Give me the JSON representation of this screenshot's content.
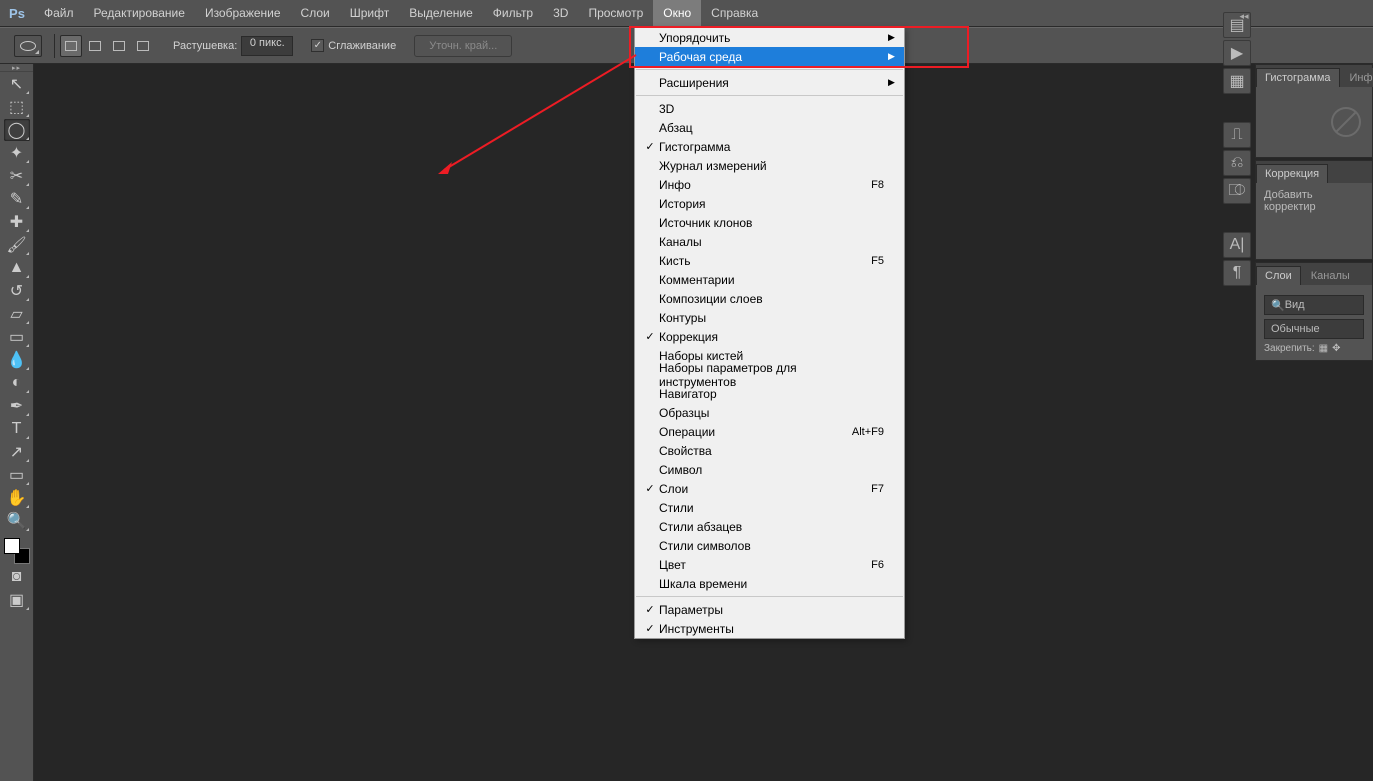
{
  "menubar": {
    "logo": "Ps",
    "items": [
      "Файл",
      "Редактирование",
      "Изображение",
      "Слои",
      "Шрифт",
      "Выделение",
      "Фильтр",
      "3D",
      "Просмотр",
      "Окно",
      "Справка"
    ],
    "active_index": 9
  },
  "options": {
    "feather_label": "Растушевка:",
    "feather_value": "0 пикс.",
    "antialias_label": "Сглаживание",
    "refine_label": "Уточн. край..."
  },
  "tools": [
    {
      "name": "move-tool",
      "glyph": "↖"
    },
    {
      "name": "marquee-tool",
      "glyph": "⬚"
    },
    {
      "name": "lasso-tool",
      "glyph": "◯",
      "selected": true
    },
    {
      "name": "wand-tool",
      "glyph": "✦"
    },
    {
      "name": "crop-tool",
      "glyph": "✂"
    },
    {
      "name": "eyedropper-tool",
      "glyph": "✎"
    },
    {
      "name": "heal-tool",
      "glyph": "✚"
    },
    {
      "name": "brush-tool",
      "glyph": "🖌"
    },
    {
      "name": "stamp-tool",
      "glyph": "▲"
    },
    {
      "name": "history-brush-tool",
      "glyph": "↺"
    },
    {
      "name": "eraser-tool",
      "glyph": "▱"
    },
    {
      "name": "gradient-tool",
      "glyph": "▭"
    },
    {
      "name": "blur-tool",
      "glyph": "💧"
    },
    {
      "name": "dodge-tool",
      "glyph": "◐"
    },
    {
      "name": "pen-tool",
      "glyph": "✒"
    },
    {
      "name": "type-tool",
      "glyph": "T"
    },
    {
      "name": "path-tool",
      "glyph": "↗"
    },
    {
      "name": "shape-tool",
      "glyph": "▭"
    },
    {
      "name": "hand-tool",
      "glyph": "✋"
    },
    {
      "name": "zoom-tool",
      "glyph": "🔍"
    }
  ],
  "dropdown": {
    "sections": [
      [
        {
          "label": "Упорядочить",
          "submenu": true
        },
        {
          "label": "Рабочая среда",
          "submenu": true,
          "highlight": true
        }
      ],
      [
        {
          "label": "Расширения",
          "submenu": true
        }
      ],
      [
        {
          "label": "3D"
        },
        {
          "label": "Абзац"
        },
        {
          "label": "Гистограмма",
          "checked": true
        },
        {
          "label": "Журнал измерений"
        },
        {
          "label": "Инфо",
          "shortcut": "F8"
        },
        {
          "label": "История"
        },
        {
          "label": "Источник клонов"
        },
        {
          "label": "Каналы"
        },
        {
          "label": "Кисть",
          "shortcut": "F5"
        },
        {
          "label": "Комментарии"
        },
        {
          "label": "Композиции слоев"
        },
        {
          "label": "Контуры"
        },
        {
          "label": "Коррекция",
          "checked": true
        },
        {
          "label": "Наборы кистей"
        },
        {
          "label": "Наборы параметров для инструментов"
        },
        {
          "label": "Навигатор"
        },
        {
          "label": "Образцы"
        },
        {
          "label": "Операции",
          "shortcut": "Alt+F9"
        },
        {
          "label": "Свойства"
        },
        {
          "label": "Символ"
        },
        {
          "label": "Слои",
          "checked": true,
          "shortcut": "F7"
        },
        {
          "label": "Стили"
        },
        {
          "label": "Стили абзацев"
        },
        {
          "label": "Стили символов"
        },
        {
          "label": "Цвет",
          "shortcut": "F6"
        },
        {
          "label": "Шкала времени"
        }
      ],
      [
        {
          "label": "Параметры",
          "checked": true
        },
        {
          "label": "Инструменты",
          "checked": true
        }
      ]
    ]
  },
  "right": {
    "histogram_tab": "Гистограмма",
    "info_tab": "Инфо",
    "adjust_tab": "Коррекция",
    "adjust_text": "Добавить корректир",
    "layers_tab": "Слои",
    "channels_tab": "Каналы",
    "kind_label": "Вид",
    "blend_mode": "Обычные",
    "lock_label": "Закрепить:"
  }
}
